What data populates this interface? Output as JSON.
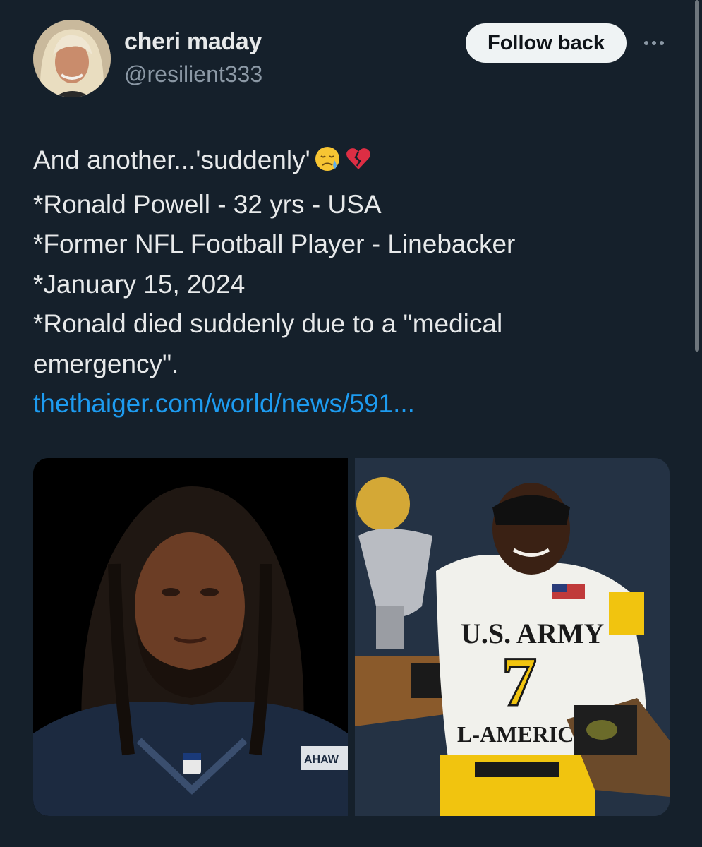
{
  "author": {
    "display_name": "cheri maday",
    "handle": "@resilient333",
    "avatar_icon": "profile-photo"
  },
  "actions": {
    "follow_label": "Follow back",
    "more_icon": "more-horizontal-icon"
  },
  "tweet": {
    "lines": [
      "And another...'suddenly'",
      "*Ronald Powell - 32 yrs - USA",
      "*Former NFL Football Player - Linebacker",
      "*January 15, 2024",
      "*Ronald died suddenly due to a \"medical emergency\"."
    ],
    "emojis": [
      "sad-tear-face-emoji",
      "broken-heart-emoji"
    ],
    "link_text": "thethaiger.com/world/news/591..."
  },
  "media": {
    "photo_1_icon": "player-headshot-photo",
    "photo_2_icon": "player-trophy-photo",
    "jersey_text": "U.S. ARMY",
    "jersey_number": "7",
    "jersey_bottom_text": "L-AMERICA",
    "headshot_jersey_text": "AHAW"
  },
  "colors": {
    "background": "#15202b",
    "link": "#1d9bf0",
    "secondary_text": "#8b98a5",
    "button_bg": "#eff3f4"
  }
}
